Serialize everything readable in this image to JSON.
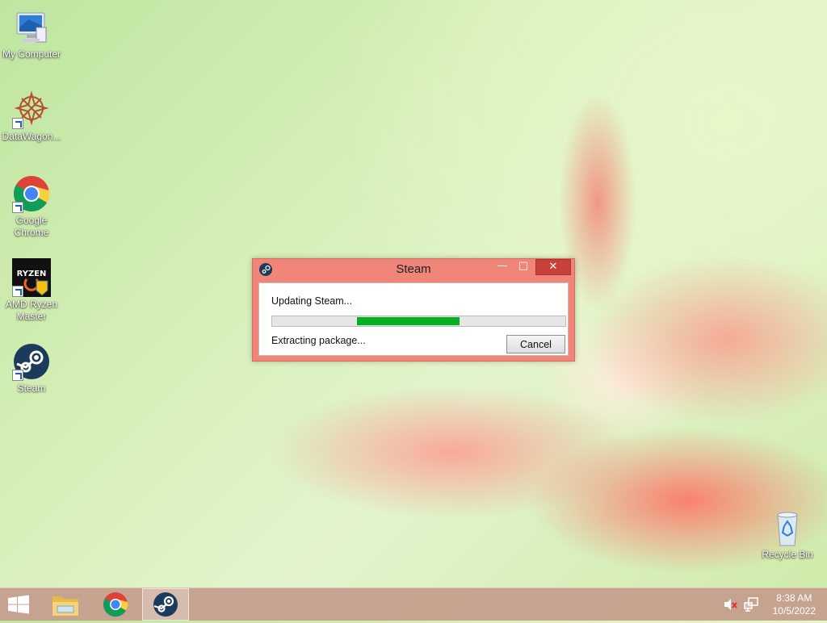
{
  "desktop": {
    "icons": [
      {
        "label": "My Computer",
        "icon": "computer-icon"
      },
      {
        "label": "DataWagon...",
        "icon": "datawagon-icon"
      },
      {
        "label": "Google Chrome",
        "icon": "chrome-icon"
      },
      {
        "label": "AMD Ryzen Master",
        "icon": "amd-ryzen-master-icon"
      },
      {
        "label": "Steam",
        "icon": "steam-icon"
      },
      {
        "label": "Recycle Bin",
        "icon": "recycle-bin-icon"
      }
    ]
  },
  "dialog": {
    "title": "Steam",
    "status": "Updating Steam...",
    "detail": "Extracting package...",
    "cancel_label": "Cancel",
    "progress": {
      "start": 0.29,
      "end": 0.64
    }
  },
  "taskbar": {
    "items": [
      "start-icon",
      "file-explorer-icon",
      "chrome-icon",
      "steam-icon"
    ],
    "clock": {
      "time": "8:38 AM",
      "date": "10/5/2022"
    }
  },
  "colors": {
    "titlebar": "#f0857a",
    "close": "#c8413a",
    "progress": "#06b025",
    "taskbar": "#c49c8c"
  }
}
